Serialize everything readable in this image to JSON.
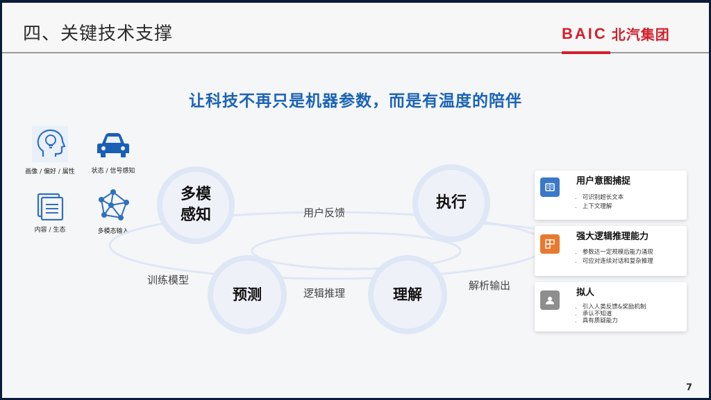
{
  "header": {
    "title": "四、关键技术支撑",
    "logo_en": "BAIC",
    "logo_cn": "北汽集团",
    "accent_color": "#d31f2a"
  },
  "headline": "让科技不再只是机器参数，而是有温度的陪伴",
  "input_icons": [
    {
      "icon": "head-lightbulb-icon",
      "label": "画像 / 偏好 / 属性"
    },
    {
      "icon": "car-icon",
      "label": "状态 / 信号感知"
    },
    {
      "icon": "documents-icon",
      "label": "内容 / 生态"
    },
    {
      "icon": "network-icon",
      "label": "多模态输入"
    }
  ],
  "cycle": {
    "nodes": {
      "perception": [
        "多模",
        "感知"
      ],
      "execute": "执行",
      "predict": "预测",
      "understand": "理解"
    },
    "labels": {
      "feedback": "用户反馈",
      "train": "训练模型",
      "reason": "逻辑推理",
      "output": "解析输出"
    },
    "ring_color": "#dfe6f5"
  },
  "cards": [
    {
      "icon": "book-icon",
      "icon_color": "#3b78c9",
      "title": "用户意图捕捉",
      "items": [
        "可识别超长文本",
        "上下文理解"
      ]
    },
    {
      "icon": "blocks-icon",
      "icon_color": "#e8792f",
      "title": "强大逻辑推理能力",
      "items": [
        "参数达一定规模后能力涌现",
        "可应对连续对话和复杂推理"
      ]
    },
    {
      "icon": "person-icon",
      "icon_color": "#8e8e8e",
      "title": "拟人",
      "items": [
        "引入人类反馈&奖励机制",
        "承认不知道",
        "具有质疑能力"
      ]
    }
  ],
  "page_number": "7"
}
